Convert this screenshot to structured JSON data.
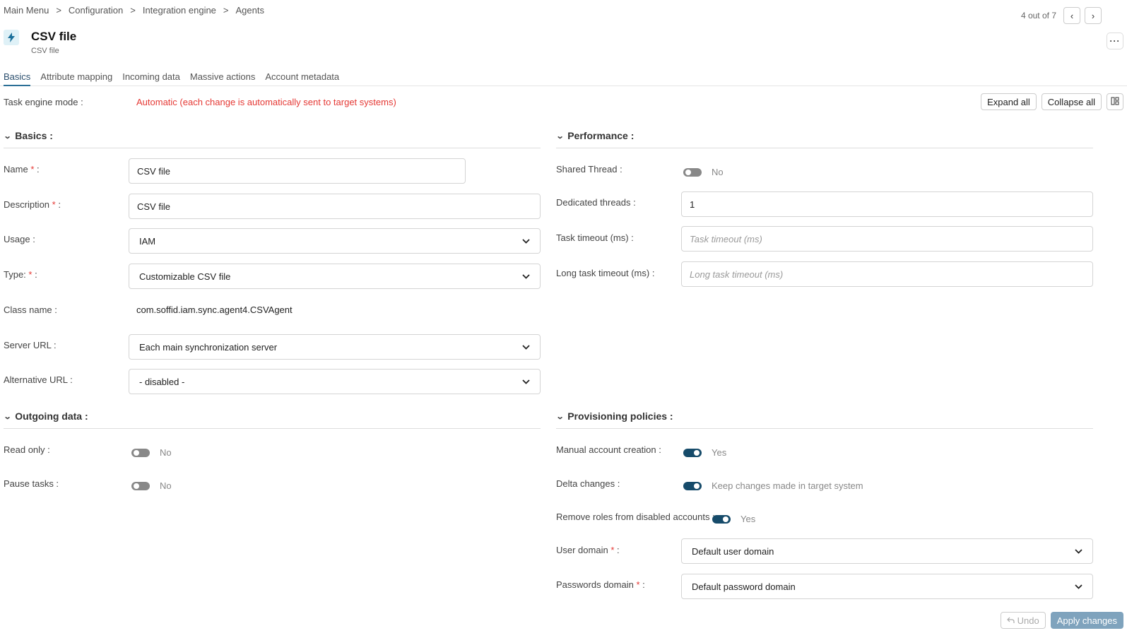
{
  "breadcrumb": [
    "Main Menu",
    "Configuration",
    "Integration engine",
    "Agents"
  ],
  "breadcrumb_separator": ">",
  "pager": {
    "text": "4 out of 7",
    "prev_icon": "‹",
    "next_icon": "›"
  },
  "header": {
    "title": "CSV file",
    "subtitle": "CSV file",
    "more_label": "···"
  },
  "tabs": [
    "Basics",
    "Attribute mapping",
    "Incoming data",
    "Massive actions",
    "Account metadata"
  ],
  "task_engine": {
    "label": "Task engine mode :",
    "value": "Automatic (each change is automatically sent to target systems)"
  },
  "actions": {
    "expand_all": "Expand all",
    "collapse_all": "Collapse all"
  },
  "basics": {
    "title": "Basics :",
    "name": {
      "label": "Name",
      "value": "CSV file"
    },
    "description": {
      "label": "Description",
      "value": "CSV file"
    },
    "usage": {
      "label": "Usage :",
      "value": "IAM"
    },
    "type": {
      "label": "Type:",
      "value": "Customizable CSV file"
    },
    "class_name": {
      "label": "Class name :",
      "value": "com.soffid.iam.sync.agent4.CSVAgent"
    },
    "server_url": {
      "label": "Server URL :",
      "value": "Each main synchronization server"
    },
    "alternative_url": {
      "label": "Alternative URL :",
      "value": "- disabled -"
    }
  },
  "performance": {
    "title": "Performance :",
    "shared_thread": {
      "label": "Shared Thread :",
      "value": "No"
    },
    "dedicated_threads": {
      "label": "Dedicated threads :",
      "value": "1"
    },
    "task_timeout": {
      "label": "Task timeout (ms) :",
      "placeholder": "Task timeout (ms)"
    },
    "long_task_timeout": {
      "label": "Long task timeout (ms) :",
      "placeholder": "Long task timeout (ms)"
    }
  },
  "outgoing": {
    "title": "Outgoing data :",
    "read_only": {
      "label": "Read only :",
      "value": "No"
    },
    "pause_tasks": {
      "label": "Pause tasks :",
      "value": "No"
    }
  },
  "provisioning": {
    "title": "Provisioning policies :",
    "manual_account": {
      "label": "Manual account creation :",
      "value": "Yes"
    },
    "delta_changes": {
      "label": "Delta changes :",
      "value": "Keep changes made in target system"
    },
    "remove_roles": {
      "label": "Remove roles from disabled accounts :",
      "value": "Yes"
    },
    "user_domain": {
      "label": "User domain",
      "value": "Default user domain"
    },
    "passwords_domain": {
      "label": "Passwords domain",
      "value": "Default password domain"
    }
  },
  "footer": {
    "undo": "Undo",
    "apply": "Apply changes"
  },
  "colors": {
    "accent": "#164b6a",
    "danger": "#e53935",
    "apply_bg": "#7fa3bd"
  }
}
